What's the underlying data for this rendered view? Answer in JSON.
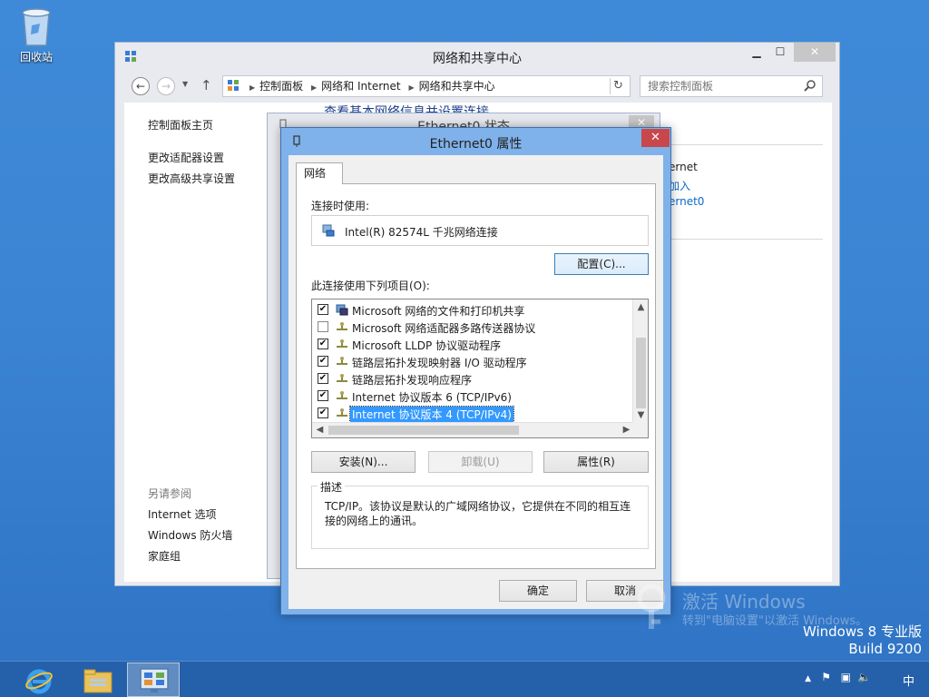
{
  "desktop": {
    "recycle_bin_label": "回收站",
    "watermark": {
      "line1": "激活 Windows",
      "line2": "转到\"电脑设置\"以激活 Windows。",
      "edition": "Windows 8 专业版",
      "build": "Build 9200"
    }
  },
  "nsc_window": {
    "title": "网络和共享中心",
    "breadcrumb": [
      "控制面板",
      "网络和 Internet",
      "网络和共享中心"
    ],
    "search_placeholder": "搜索控制面板",
    "sidebar": {
      "home": "控制面板主页",
      "adapter_settings": "更改适配器设置",
      "advanced_sharing": "更改高级共享设置",
      "see_also": "另请参阅",
      "internet_options": "Internet 选项",
      "firewall": "Windows 防火墙",
      "homegroup": "家庭组"
    },
    "main_heading": "查看基本网络信息并设置连接",
    "partial_texts": [
      "ernet",
      "加入",
      "ernet0"
    ]
  },
  "status_window": {
    "title": "Ethernet0 状态"
  },
  "properties_dialog": {
    "title": "Ethernet0 属性",
    "tab_label": "网络",
    "connect_using_label": "连接时使用:",
    "adapter_name": "Intel(R) 82574L 千兆网络连接",
    "configure_button": "配置(C)...",
    "items_label": "此连接使用下列项目(O):",
    "components": [
      {
        "label": "Microsoft 网络的文件和打印机共享",
        "checked": true,
        "icon": "printer-share-icon"
      },
      {
        "label": "Microsoft 网络适配器多路传送器协议",
        "checked": false,
        "icon": "protocol-icon"
      },
      {
        "label": "Microsoft LLDP 协议驱动程序",
        "checked": true,
        "icon": "protocol-icon"
      },
      {
        "label": "链路层拓扑发现映射器 I/O 驱动程序",
        "checked": true,
        "icon": "protocol-icon"
      },
      {
        "label": "链路层拓扑发现响应程序",
        "checked": true,
        "icon": "protocol-icon"
      },
      {
        "label": "Internet 协议版本 6 (TCP/IPv6)",
        "checked": true,
        "icon": "protocol-icon"
      },
      {
        "label": "Internet 协议版本 4 (TCP/IPv4)",
        "checked": true,
        "icon": "protocol-icon",
        "selected": true
      }
    ],
    "install_button": "安装(N)...",
    "uninstall_button": "卸载(U)",
    "properties_button": "属性(R)",
    "description_title": "描述",
    "description_text": "TCP/IP。该协议是默认的广域网络协议，它提供在不同的相互连接的网络上的通讯。",
    "ok_button": "确定",
    "cancel_button": "取消"
  },
  "taskbar": {
    "apps": [
      "internet-explorer-icon",
      "file-explorer-icon",
      "control-panel-icon"
    ],
    "ime_indicator": "中"
  },
  "colors": {
    "desktop": "#3b84d3",
    "selection": "#3399ff",
    "dialog_frame": "#7fb1ea",
    "close_button": "#c7474a"
  }
}
